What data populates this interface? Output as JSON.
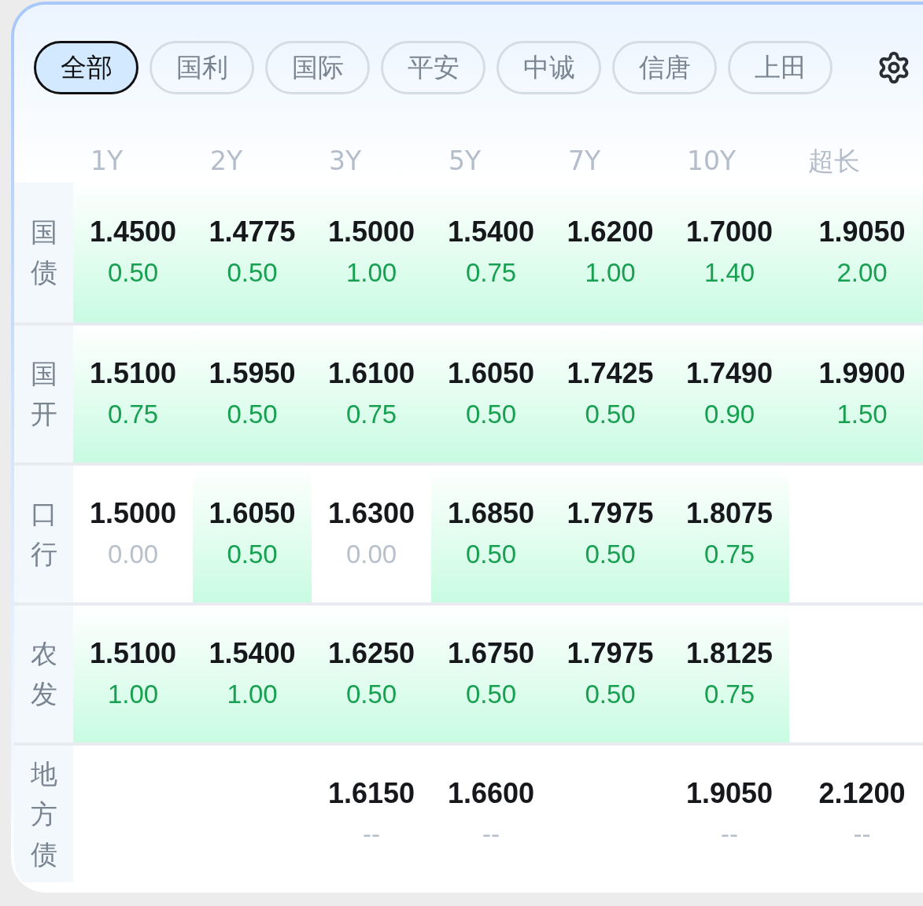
{
  "tabs": [
    {
      "label": "全部",
      "selected": true
    },
    {
      "label": "国利",
      "selected": false
    },
    {
      "label": "国际",
      "selected": false
    },
    {
      "label": "平安",
      "selected": false
    },
    {
      "label": "中诚",
      "selected": false
    },
    {
      "label": "信唐",
      "selected": false
    },
    {
      "label": "上田",
      "selected": false
    }
  ],
  "table": {
    "columns": [
      "1Y",
      "2Y",
      "3Y",
      "5Y",
      "7Y",
      "10Y",
      "超长"
    ],
    "rows": [
      {
        "label": "国债",
        "cells": [
          {
            "rate": "1.4500",
            "change": "0.50",
            "kind": "up"
          },
          {
            "rate": "1.4775",
            "change": "0.50",
            "kind": "up"
          },
          {
            "rate": "1.5000",
            "change": "1.00",
            "kind": "up"
          },
          {
            "rate": "1.5400",
            "change": "0.75",
            "kind": "up"
          },
          {
            "rate": "1.6200",
            "change": "1.00",
            "kind": "up"
          },
          {
            "rate": "1.7000",
            "change": "1.40",
            "kind": "up"
          },
          {
            "rate": "1.9050",
            "change": "2.00",
            "kind": "up"
          }
        ]
      },
      {
        "label": "国开",
        "cells": [
          {
            "rate": "1.5100",
            "change": "0.75",
            "kind": "up"
          },
          {
            "rate": "1.5950",
            "change": "0.50",
            "kind": "up"
          },
          {
            "rate": "1.6100",
            "change": "0.75",
            "kind": "up"
          },
          {
            "rate": "1.6050",
            "change": "0.50",
            "kind": "up"
          },
          {
            "rate": "1.7425",
            "change": "0.50",
            "kind": "up"
          },
          {
            "rate": "1.7490",
            "change": "0.90",
            "kind": "up"
          },
          {
            "rate": "1.9900",
            "change": "1.50",
            "kind": "up"
          }
        ]
      },
      {
        "label": "口行",
        "cells": [
          {
            "rate": "1.5000",
            "change": "0.00",
            "kind": "flat"
          },
          {
            "rate": "1.6050",
            "change": "0.50",
            "kind": "up"
          },
          {
            "rate": "1.6300",
            "change": "0.00",
            "kind": "flat"
          },
          {
            "rate": "1.6850",
            "change": "0.50",
            "kind": "up"
          },
          {
            "rate": "1.7975",
            "change": "0.50",
            "kind": "up"
          },
          {
            "rate": "1.8075",
            "change": "0.75",
            "kind": "up"
          },
          null
        ]
      },
      {
        "label": "农发",
        "cells": [
          {
            "rate": "1.5100",
            "change": "1.00",
            "kind": "up"
          },
          {
            "rate": "1.5400",
            "change": "1.00",
            "kind": "up"
          },
          {
            "rate": "1.6250",
            "change": "0.50",
            "kind": "up"
          },
          {
            "rate": "1.6750",
            "change": "0.50",
            "kind": "up"
          },
          {
            "rate": "1.7975",
            "change": "0.50",
            "kind": "up"
          },
          {
            "rate": "1.8125",
            "change": "0.75",
            "kind": "up"
          },
          null
        ]
      },
      {
        "label": "地方债",
        "cells": [
          null,
          null,
          {
            "rate": "1.6150",
            "change": "--",
            "kind": "none"
          },
          {
            "rate": "1.6600",
            "change": "--",
            "kind": "none"
          },
          null,
          {
            "rate": "1.9050",
            "change": "--",
            "kind": "none"
          },
          {
            "rate": "2.1200",
            "change": "--",
            "kind": "none"
          }
        ]
      }
    ]
  }
}
